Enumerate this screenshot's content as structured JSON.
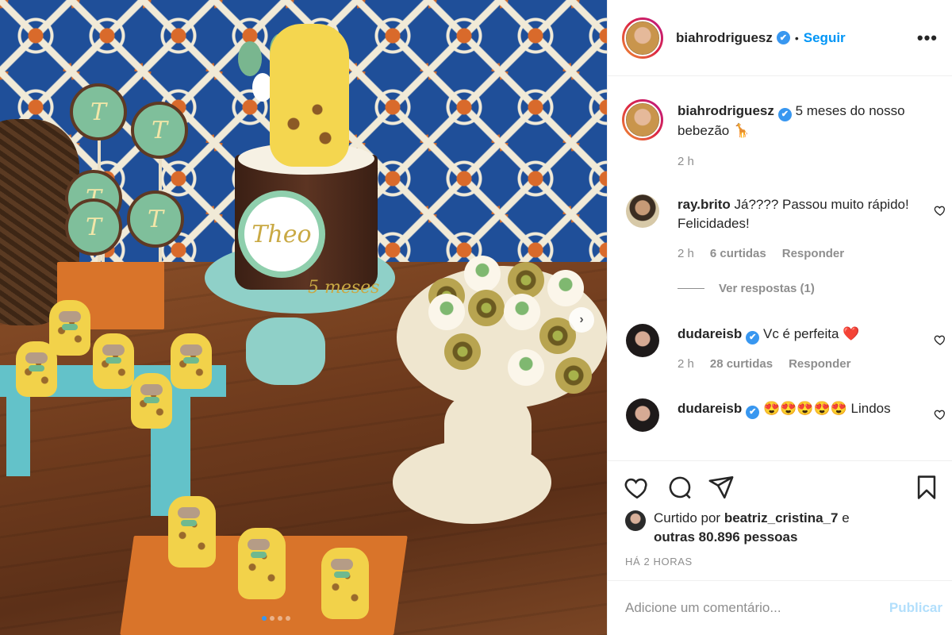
{
  "post": {
    "username": "biahrodriguesz",
    "verified_badge": "✔",
    "bullet": "•",
    "follow_label": "Seguir",
    "more_icon": "more-options-icon",
    "more_glyph": "•••",
    "photo": {
      "cake_name": "Theo",
      "cake_months": "5 meses",
      "pop_letter": "T",
      "next_glyph": "›"
    }
  },
  "caption": {
    "username": "biahrodriguesz",
    "text": "5 meses do nosso bebezão 🦒",
    "time": "2 h"
  },
  "comments": [
    {
      "username": "ray.brito",
      "text": "Já???? Passou muito rápido! Felicidades!",
      "time": "2 h",
      "likes": "6 curtidas",
      "reply": "Responder",
      "view_replies": "Ver respostas (1)"
    },
    {
      "username": "dudareisb",
      "text": "Vc é perfeita ❤️",
      "time": "2 h",
      "likes": "28 curtidas",
      "reply": "Responder"
    },
    {
      "username": "dudareisb",
      "text": "😍😍😍😍😍 Lindos"
    }
  ],
  "likes": {
    "prefix": "Curtido por ",
    "user": "beatriz_cristina_7",
    "middle": " e ",
    "others": "outras 80.896 pessoas"
  },
  "timestamp": "HÁ 2 HORAS",
  "add_comment": {
    "placeholder": "Adicione um comentário...",
    "publish_label": "Publicar"
  },
  "colors": {
    "link_blue": "#0095f6",
    "verified_blue": "#3897f0",
    "muted_text": "#8e8e8e",
    "publish_disabled": "#b2dffc"
  }
}
